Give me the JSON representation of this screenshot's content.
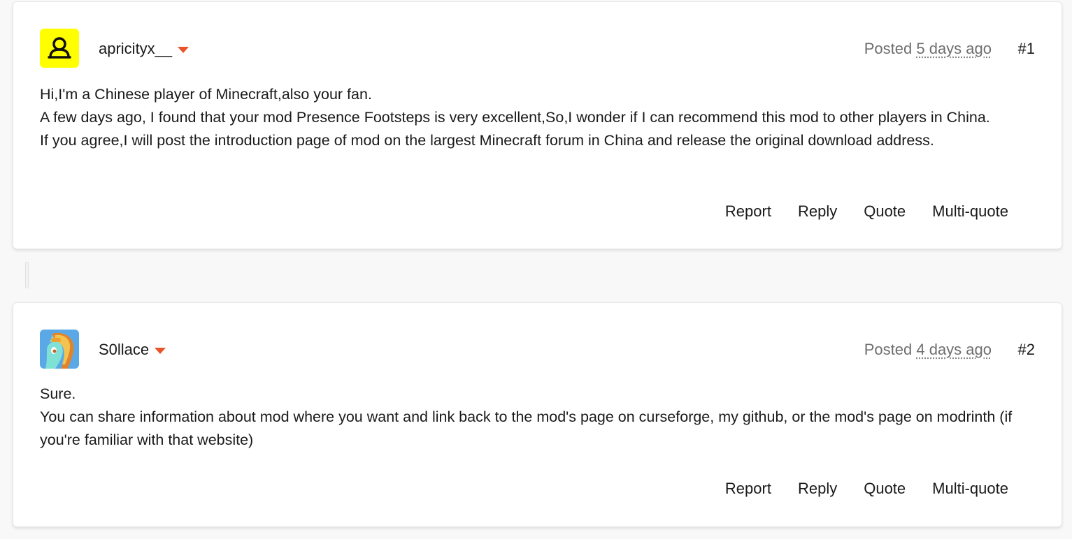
{
  "posts": [
    {
      "author": "apricityx__",
      "avatar_icon": "user-outline-icon",
      "avatar_color": "#ffff00",
      "posted_prefix": "Posted",
      "posted_ago": "5 days ago",
      "number": "#1",
      "lines": [
        "Hi,I'm a Chinese player of Minecraft,also your fan.",
        "A few days ago, I found that your mod Presence Footsteps is very excellent,So,I wonder if I can recommend this mod to other players in China.",
        "If you agree,I will post the introduction page of mod on the largest Minecraft forum in China and release the original download address."
      ],
      "actions": {
        "report": "Report",
        "reply": "Reply",
        "quote": "Quote",
        "multiquote": "Multi-quote"
      }
    },
    {
      "author": "S0llace",
      "avatar_icon": "pony-avatar-icon",
      "avatar_color": "#5aa9e6",
      "posted_prefix": "Posted",
      "posted_ago": "4 days ago",
      "number": "#2",
      "lines": [
        "Sure.",
        "You can share information about mod where you want and link back to the mod's page on curseforge, my github, or the mod's page on modrinth (if you're familiar with that website)"
      ],
      "actions": {
        "report": "Report",
        "reply": "Reply",
        "quote": "Quote",
        "multiquote": "Multi-quote"
      }
    }
  ],
  "colors": {
    "accent": "#e9542a",
    "muted_text": "#6e6e6e",
    "background": "#f8f8f8"
  }
}
